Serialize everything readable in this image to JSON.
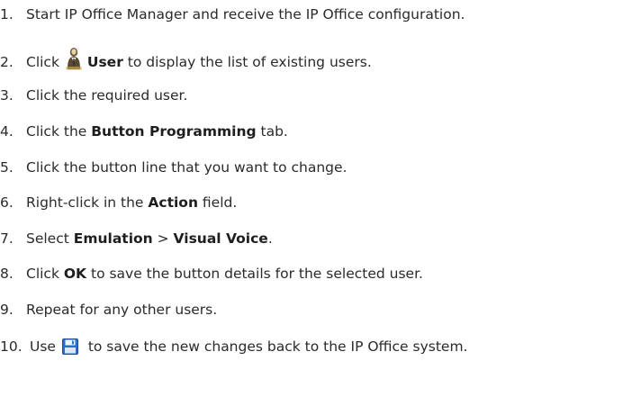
{
  "steps": [
    {
      "num": "1.",
      "text": "Start IP Office Manager and receive the IP Office configuration."
    },
    {
      "num": "2.",
      "pre": "Click ",
      "icon": "user-icon",
      "bold": "User",
      "post": " to display the list of existing users."
    },
    {
      "num": "3.",
      "text": "Click the required user."
    },
    {
      "num": "4.",
      "pre": "Click the ",
      "bold": "Button Programming",
      "post": " tab."
    },
    {
      "num": "5.",
      "text": "Click the button line that you want to change."
    },
    {
      "num": "6.",
      "pre": "Right-click in the ",
      "bold": "Action",
      "post": " field."
    },
    {
      "num": "7.",
      "pre": "Select ",
      "bold": "Emulation",
      "mid": " > ",
      "bold2": "Visual Voice",
      "post": "."
    },
    {
      "num": "8.",
      "pre": "Click ",
      "bold": "OK",
      "post": " to save the button details for the selected user."
    },
    {
      "num": "9.",
      "text": "Repeat for any other users."
    },
    {
      "num": "10.",
      "pre": "Use ",
      "icon": "save-icon",
      "post": " to save the new changes back to the IP Office system."
    }
  ]
}
